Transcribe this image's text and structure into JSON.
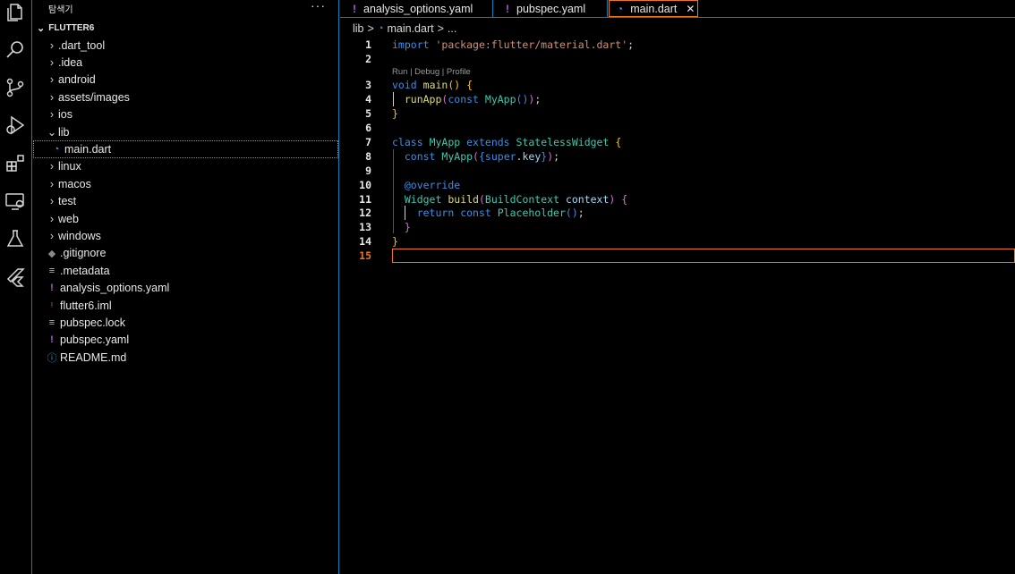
{
  "activity_bar": {
    "icons": [
      "files-icon",
      "search-icon",
      "source-control-icon",
      "run-debug-icon",
      "extensions-icon",
      "remote-explorer-icon",
      "testing-icon",
      "flutter-icon"
    ]
  },
  "sidebar": {
    "title": "탐색기",
    "more": "···",
    "root": "FLUTTER6",
    "items": [
      {
        "label": ".dart_tool",
        "type": "folder"
      },
      {
        "label": ".idea",
        "type": "folder"
      },
      {
        "label": "android",
        "type": "folder"
      },
      {
        "label": "assets/images",
        "type": "folder"
      },
      {
        "label": "ios",
        "type": "folder"
      },
      {
        "label": "lib",
        "type": "folder-open"
      },
      {
        "label": "main.dart",
        "type": "dart-file"
      },
      {
        "label": "linux",
        "type": "folder"
      },
      {
        "label": "macos",
        "type": "folder"
      },
      {
        "label": "test",
        "type": "folder"
      },
      {
        "label": "web",
        "type": "folder"
      },
      {
        "label": "windows",
        "type": "folder"
      },
      {
        "label": ".gitignore",
        "type": "git-file"
      },
      {
        "label": ".metadata",
        "type": "text-file"
      },
      {
        "label": "analysis_options.yaml",
        "type": "yaml-file"
      },
      {
        "label": "flutter6.iml",
        "type": "rss-file"
      },
      {
        "label": "pubspec.lock",
        "type": "text-file"
      },
      {
        "label": "pubspec.yaml",
        "type": "yaml-file"
      },
      {
        "label": "README.md",
        "type": "info-file"
      }
    ]
  },
  "tabs": [
    {
      "label": "analysis_options.yaml",
      "icon": "!"
    },
    {
      "label": "pubspec.yaml",
      "icon": "!"
    },
    {
      "label": "main.dart",
      "icon": "◔",
      "close": "✕"
    }
  ],
  "breadcrumb": {
    "part1": "lib",
    "sep": ">",
    "part2": "main.dart",
    "sep2": ">",
    "part3": "..."
  },
  "editor": {
    "line_numbers": [
      "1",
      "2",
      "3",
      "4",
      "5",
      "6",
      "7",
      "8",
      "9",
      "10",
      "11",
      "12",
      "13",
      "14",
      "15"
    ],
    "code_lens": "Run | Debug | Profile",
    "code": {
      "l1_kw": "import",
      "l1_str": "'package:flutter/material.dart'",
      "l1_end": ";",
      "l3_kw": "void",
      "l3_fn": "main",
      "l3_p": "()",
      "l3_b": "{",
      "l4_fn": "runApp",
      "l4_p1": "(",
      "l4_kw": "const",
      "l4_cls": "MyApp",
      "l4_p2": "()",
      "l4_p3": ")",
      "l4_end": ";",
      "l5_b": "}",
      "l7_kw1": "class",
      "l7_cls1": "MyApp",
      "l7_kw2": "extends",
      "l7_cls2": "StatelessWidget",
      "l7_b": "{",
      "l8_kw": "const",
      "l8_cls": "MyApp",
      "l8_p1": "(",
      "l8_b1": "{",
      "l8_kw2": "super",
      "l8_dot": ".",
      "l8_key": "key",
      "l8_b2": "}",
      "l8_p2": ")",
      "l8_end": ";",
      "l10_ann": "@override",
      "l11_cls": "Widget",
      "l11_fn": "build",
      "l11_p1": "(",
      "l11_cls2": "BuildContext",
      "l11_param": "context",
      "l11_p2": ")",
      "l11_b": "{",
      "l12_kw1": "return",
      "l12_kw2": "const",
      "l12_cls": "Placeholder",
      "l12_p": "()",
      "l12_end": ";",
      "l13_b": "}",
      "l14_b": "}"
    }
  },
  "colors": {
    "accent_border": "#0e7fb5",
    "focus": "#f0761d"
  }
}
